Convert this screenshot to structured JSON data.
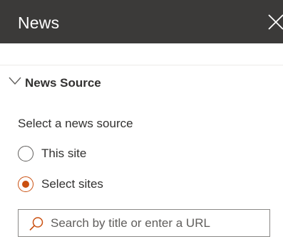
{
  "panel": {
    "title": "News",
    "close_icon": "close-icon"
  },
  "section": {
    "title": "News Source",
    "expanded": true,
    "chevron_icon": "chevron-down-icon"
  },
  "news_source": {
    "label": "Select a news source",
    "options": [
      {
        "label": "This site",
        "checked": false
      },
      {
        "label": "Select sites",
        "checked": true
      }
    ],
    "accent_color": "#ca5010"
  },
  "search": {
    "placeholder": "Search by title or enter a URL",
    "value": "",
    "icon": "search-icon"
  },
  "colors": {
    "header_bg": "#3b3a39",
    "accent": "#ca5010"
  }
}
